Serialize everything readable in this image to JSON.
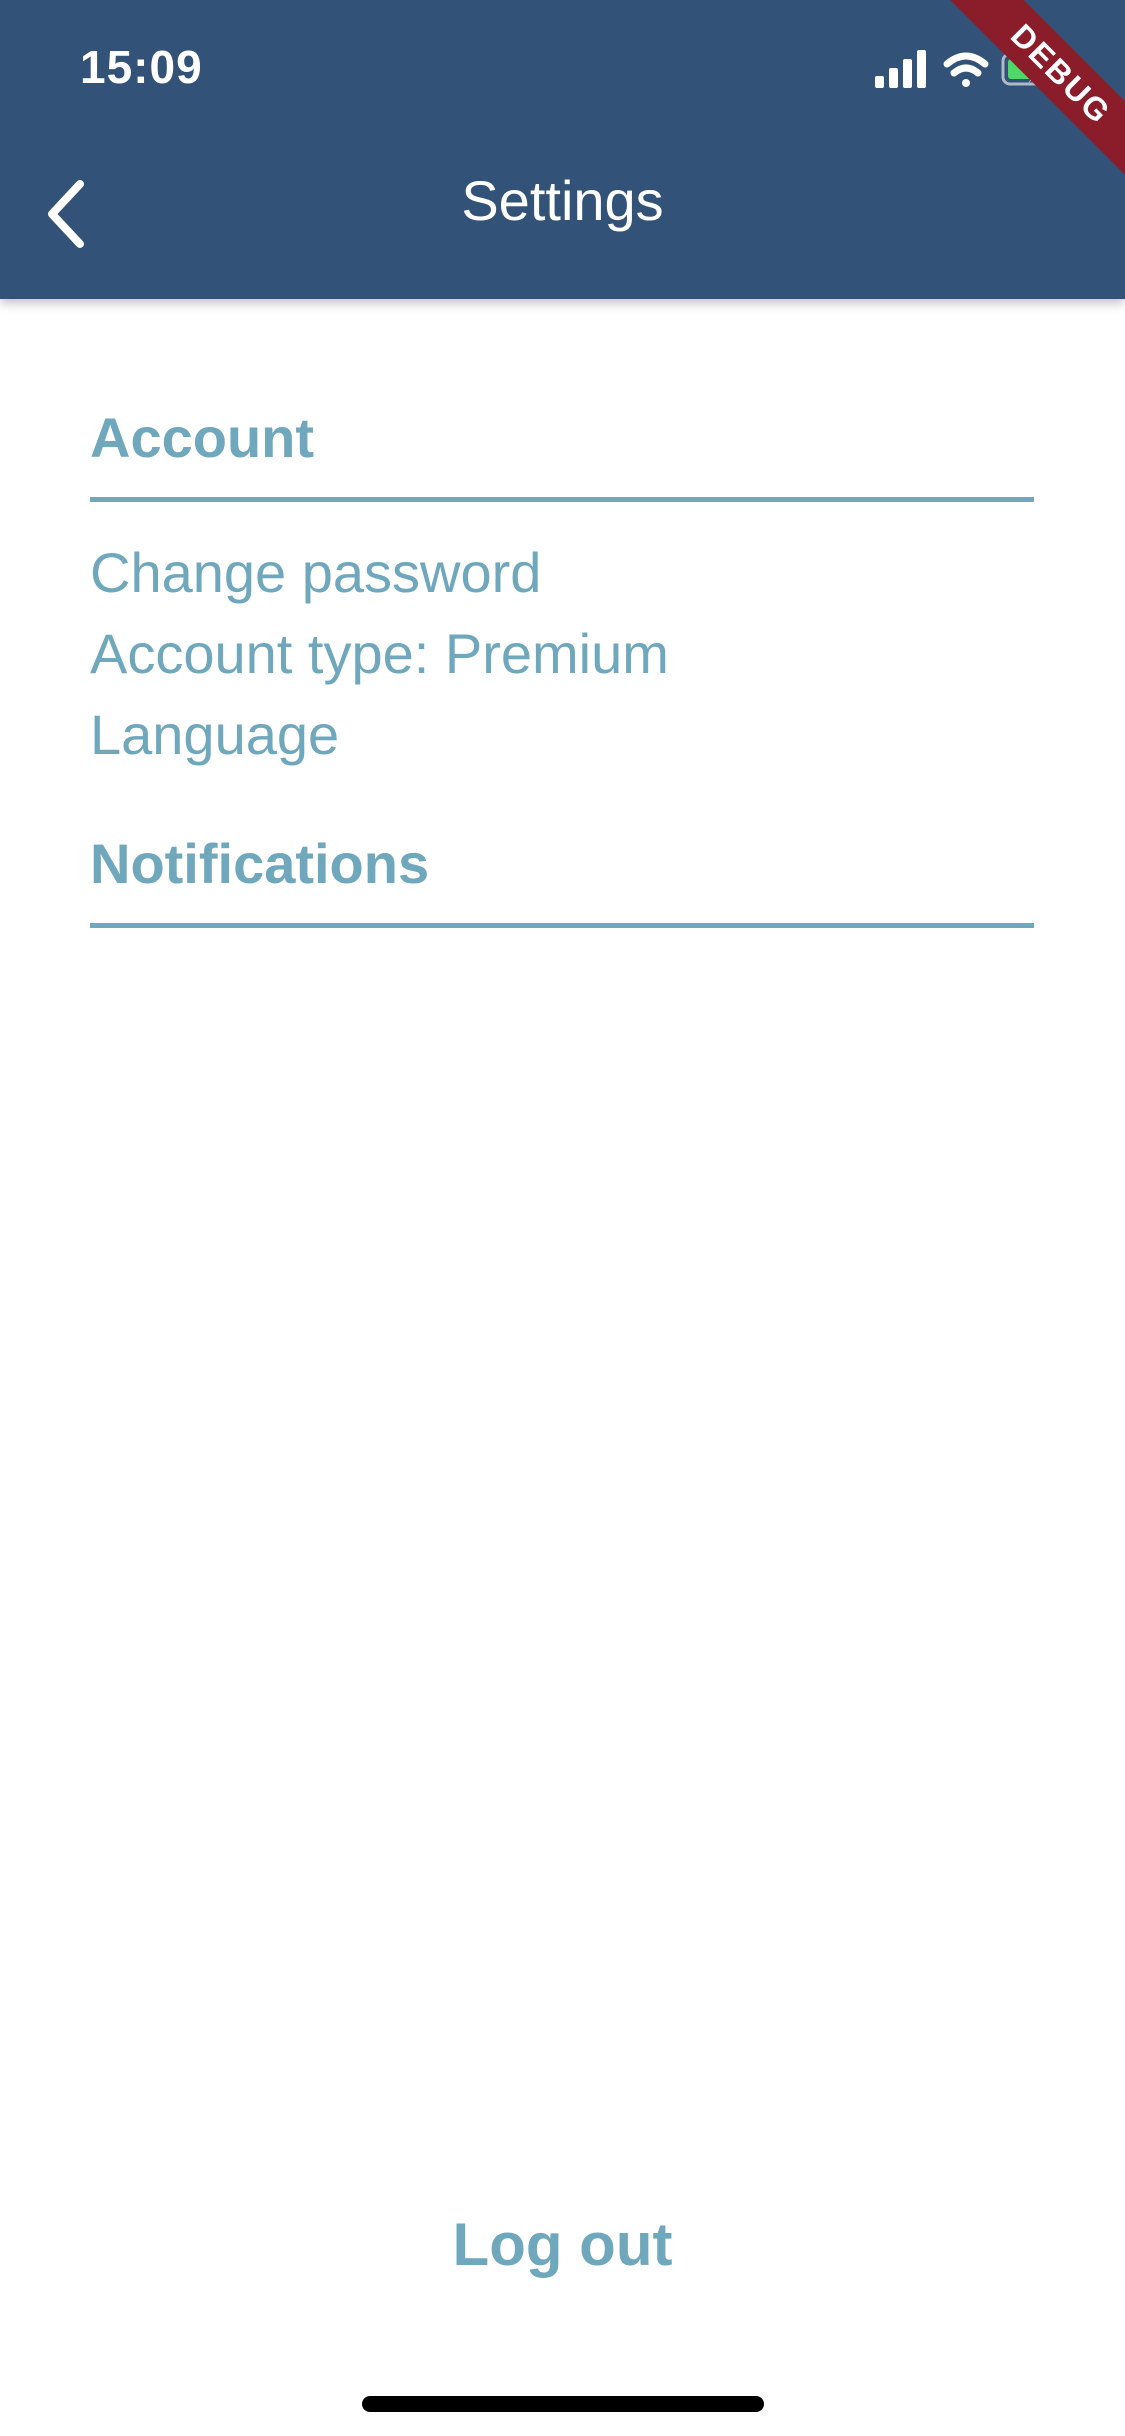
{
  "status_bar": {
    "time": "15:09",
    "signal_icon": "cellular-signal-icon",
    "wifi_icon": "wifi-icon",
    "battery_icon": "battery-charging-icon"
  },
  "debug_banner": {
    "label": "DEBUG",
    "color": "#8b1c2a"
  },
  "app_bar": {
    "title": "Settings",
    "back_icon": "chevron-left-icon",
    "color": "#325377"
  },
  "colors": {
    "accent": "#6fa7bc",
    "background": "#ffffff"
  },
  "sections": {
    "account": {
      "title": "Account",
      "items": [
        {
          "label": "Change password"
        },
        {
          "label": "Account type: Premium"
        },
        {
          "label": "Language"
        }
      ]
    },
    "notifications": {
      "title": "Notifications"
    }
  },
  "logout": {
    "label": "Log out"
  }
}
